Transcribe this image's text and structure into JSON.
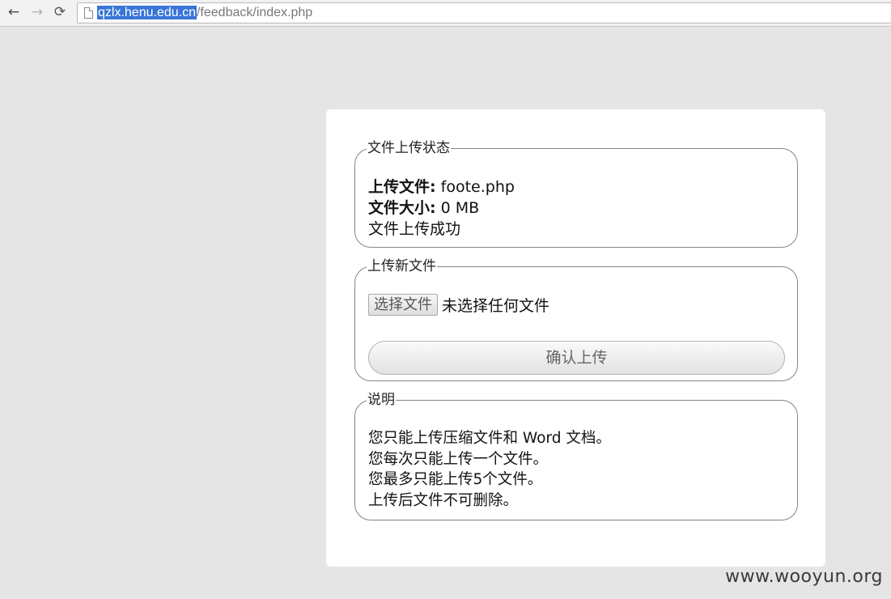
{
  "browser": {
    "back_icon": "←",
    "forward_icon": "→",
    "reload_icon": "⟳",
    "url_host": "qzlx.henu.edu.cn",
    "url_path": "/feedback/index.php"
  },
  "status_panel": {
    "legend": "文件上传状态",
    "file_label": "上传文件:",
    "file_value": "foote.php",
    "size_label": "文件大小:",
    "size_value": "0 MB",
    "message": "文件上传成功"
  },
  "upload_panel": {
    "legend": "上传新文件",
    "choose_button": "选择文件",
    "no_file_text": "未选择任何文件",
    "submit_button": "确认上传"
  },
  "notes_panel": {
    "legend": "说明",
    "lines": [
      "您只能上传压缩文件和 Word 文档。",
      "您每次只能上传一个文件。",
      "您最多只能上传5个文件。",
      "上传后文件不可删除。"
    ]
  },
  "watermark": "www.wooyun.org"
}
